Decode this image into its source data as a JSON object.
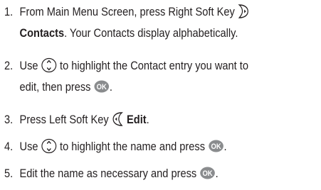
{
  "steps": [
    {
      "number": "1.",
      "line1_prefix": "From Main Menu Screen, press Right Soft Key",
      "line2_bold": "Contacts",
      "line2_suffix": ". Your Contacts display alphabetically."
    },
    {
      "number": "2.",
      "line1_prefix": "Use",
      "line1_suffix": "to highlight the Contact entry you want to",
      "line2_prefix": "edit, then press",
      "line2_suffix": "."
    },
    {
      "number": "3.",
      "line1_prefix": "Press Left Soft Key",
      "line1_bold": "Edit",
      "line1_suffix": "."
    },
    {
      "number": "4.",
      "line1_prefix": "Use",
      "line1_suffix": "to highlight the name and press",
      "line1_end": "."
    },
    {
      "number": "5.",
      "line1_prefix": "Edit the name as necessary and press",
      "line1_end": "."
    }
  ],
  "icons": {
    "right_soft_key": "right-soft-key-icon",
    "left_soft_key": "left-soft-key-icon",
    "nav_key": "navigation-key-icon",
    "ok_key": "ok-key-icon",
    "ok_label": "OK"
  }
}
